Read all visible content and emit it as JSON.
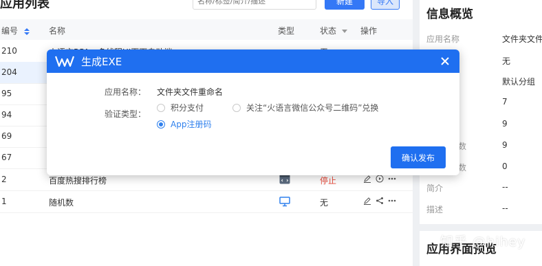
{
  "main": {
    "page_title": "应用列表",
    "search_placeholder": "名称/标签/简介/描述",
    "new_button": "新建",
    "import_button": "导入",
    "columns": {
      "id": "编号",
      "name": "名称",
      "type": "类型",
      "status": "状态",
      "ops": "操作"
    },
    "rows": [
      {
        "id": "210",
        "name": "火语言RPA - 多线程UI页面自动端",
        "status": "无"
      },
      {
        "id": "204",
        "name": "",
        "status": ""
      },
      {
        "id": "95",
        "name": "",
        "status": ""
      },
      {
        "id": "94",
        "name": "",
        "status": ""
      },
      {
        "id": "69",
        "name": "",
        "status": ""
      },
      {
        "id": "67",
        "name": "",
        "status": ""
      },
      {
        "id": "2",
        "name": "百度热搜排行榜",
        "status": "停止"
      },
      {
        "id": "1",
        "name": "随机数",
        "status": "无"
      }
    ]
  },
  "info_panel": {
    "title": "信息概览",
    "items": [
      {
        "label": "应用名称",
        "value": "文件夹文件"
      },
      {
        "label": "",
        "value": "无"
      },
      {
        "label": "",
        "value": "默认分组"
      },
      {
        "label": "",
        "value": "7"
      },
      {
        "label": "",
        "value": "9"
      },
      {
        "label": "数",
        "value": "9"
      },
      {
        "label": "数",
        "value": "0"
      },
      {
        "label": "简介",
        "value": "--"
      },
      {
        "label": "描述",
        "value": "--"
      }
    ]
  },
  "preview_panel": {
    "title": "应用界面预览"
  },
  "watermark": "知乎 @hihey",
  "modal": {
    "title": "生成EXE",
    "app_name_label": "应用名称：",
    "app_name_value": "文件夹文件重命名",
    "verify_label": "验证类型：",
    "options": [
      {
        "label": "积分支付",
        "checked": false
      },
      {
        "label": "关注“火语言微信公众号二维码”兑换",
        "checked": false
      },
      {
        "label": "App注册码",
        "checked": true
      }
    ],
    "confirm_button": "确认发布"
  },
  "colors": {
    "primary": "#1f6ff0",
    "stop": "#e84b3c",
    "highlight_row": "#eaf2fe"
  },
  "icons": [
    "sort-icon",
    "desktop-icon",
    "code-window-icon",
    "edit-icon",
    "share-icon",
    "play-icon",
    "more-icon",
    "logo-icon",
    "close-icon"
  ]
}
